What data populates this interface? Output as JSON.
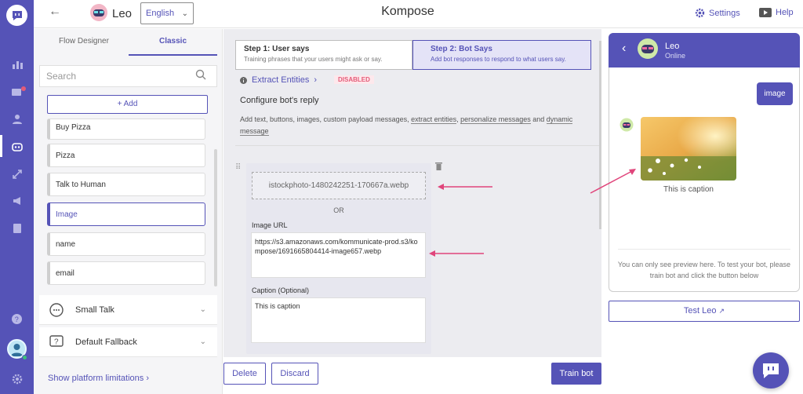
{
  "app": {
    "title": "Kompose",
    "bot_name": "Leo",
    "language": "English",
    "settings_label": "Settings",
    "help_label": "Help",
    "accent_color": "#5553b7"
  },
  "rail": {
    "icons": [
      "chat-logo-icon",
      "analytics-icon",
      "conversations-icon",
      "users-icon",
      "bot-icon",
      "integrations-icon",
      "campaigns-icon",
      "reports-icon",
      "help-circle-icon",
      "user-avatar",
      "settings-gear-icon"
    ]
  },
  "left_panel": {
    "tabs": [
      {
        "label": "Flow Designer"
      },
      {
        "label": "Classic"
      }
    ],
    "search_placeholder": "Search",
    "add_label": "+ Add",
    "intents": [
      {
        "label": "Buy Pizza"
      },
      {
        "label": "Pizza"
      },
      {
        "label": "Talk to Human"
      },
      {
        "label": "Image"
      },
      {
        "label": "name"
      },
      {
        "label": "email"
      }
    ],
    "sections": [
      {
        "label": "Small Talk"
      },
      {
        "label": "Default Fallback"
      }
    ],
    "platform_link": "Show platform limitations"
  },
  "center": {
    "step1": {
      "title": "Step 1: User says",
      "desc": "Training phrases that your users might ask or say."
    },
    "step2": {
      "title": "Step 2: Bot Says",
      "desc": "Add bot responses to respond to what users say."
    },
    "extract_entities": "Extract Entities",
    "disabled_badge": "DISABLED",
    "configure_title": "Configure bot's reply",
    "configure_desc_a": "Add text, buttons, images, custom payload messages, ",
    "configure_link_1": "extract entities",
    "configure_sep": ", ",
    "configure_link_2": "personalize messages",
    "configure_desc_b": " and ",
    "configure_link_3": "dynamic message",
    "file_name": "istockphoto-1480242251-170667a.webp",
    "or_label": "OR",
    "image_url_label": "Image URL",
    "image_url_value": "https://s3.amazonaws.com/kommunicate-prod.s3/kompose/1691665804414-image657.webp",
    "caption_label": "Caption (Optional)",
    "caption_value": "This is caption",
    "delete_label": "Delete",
    "discard_label": "Discard",
    "train_label": "Train bot"
  },
  "preview": {
    "bot_name": "Leo",
    "status": "Online",
    "user_message": "image",
    "caption": "This is caption",
    "note": "You can only see preview here. To test your bot, please train bot and click the button below",
    "test_button": "Test Leo"
  }
}
